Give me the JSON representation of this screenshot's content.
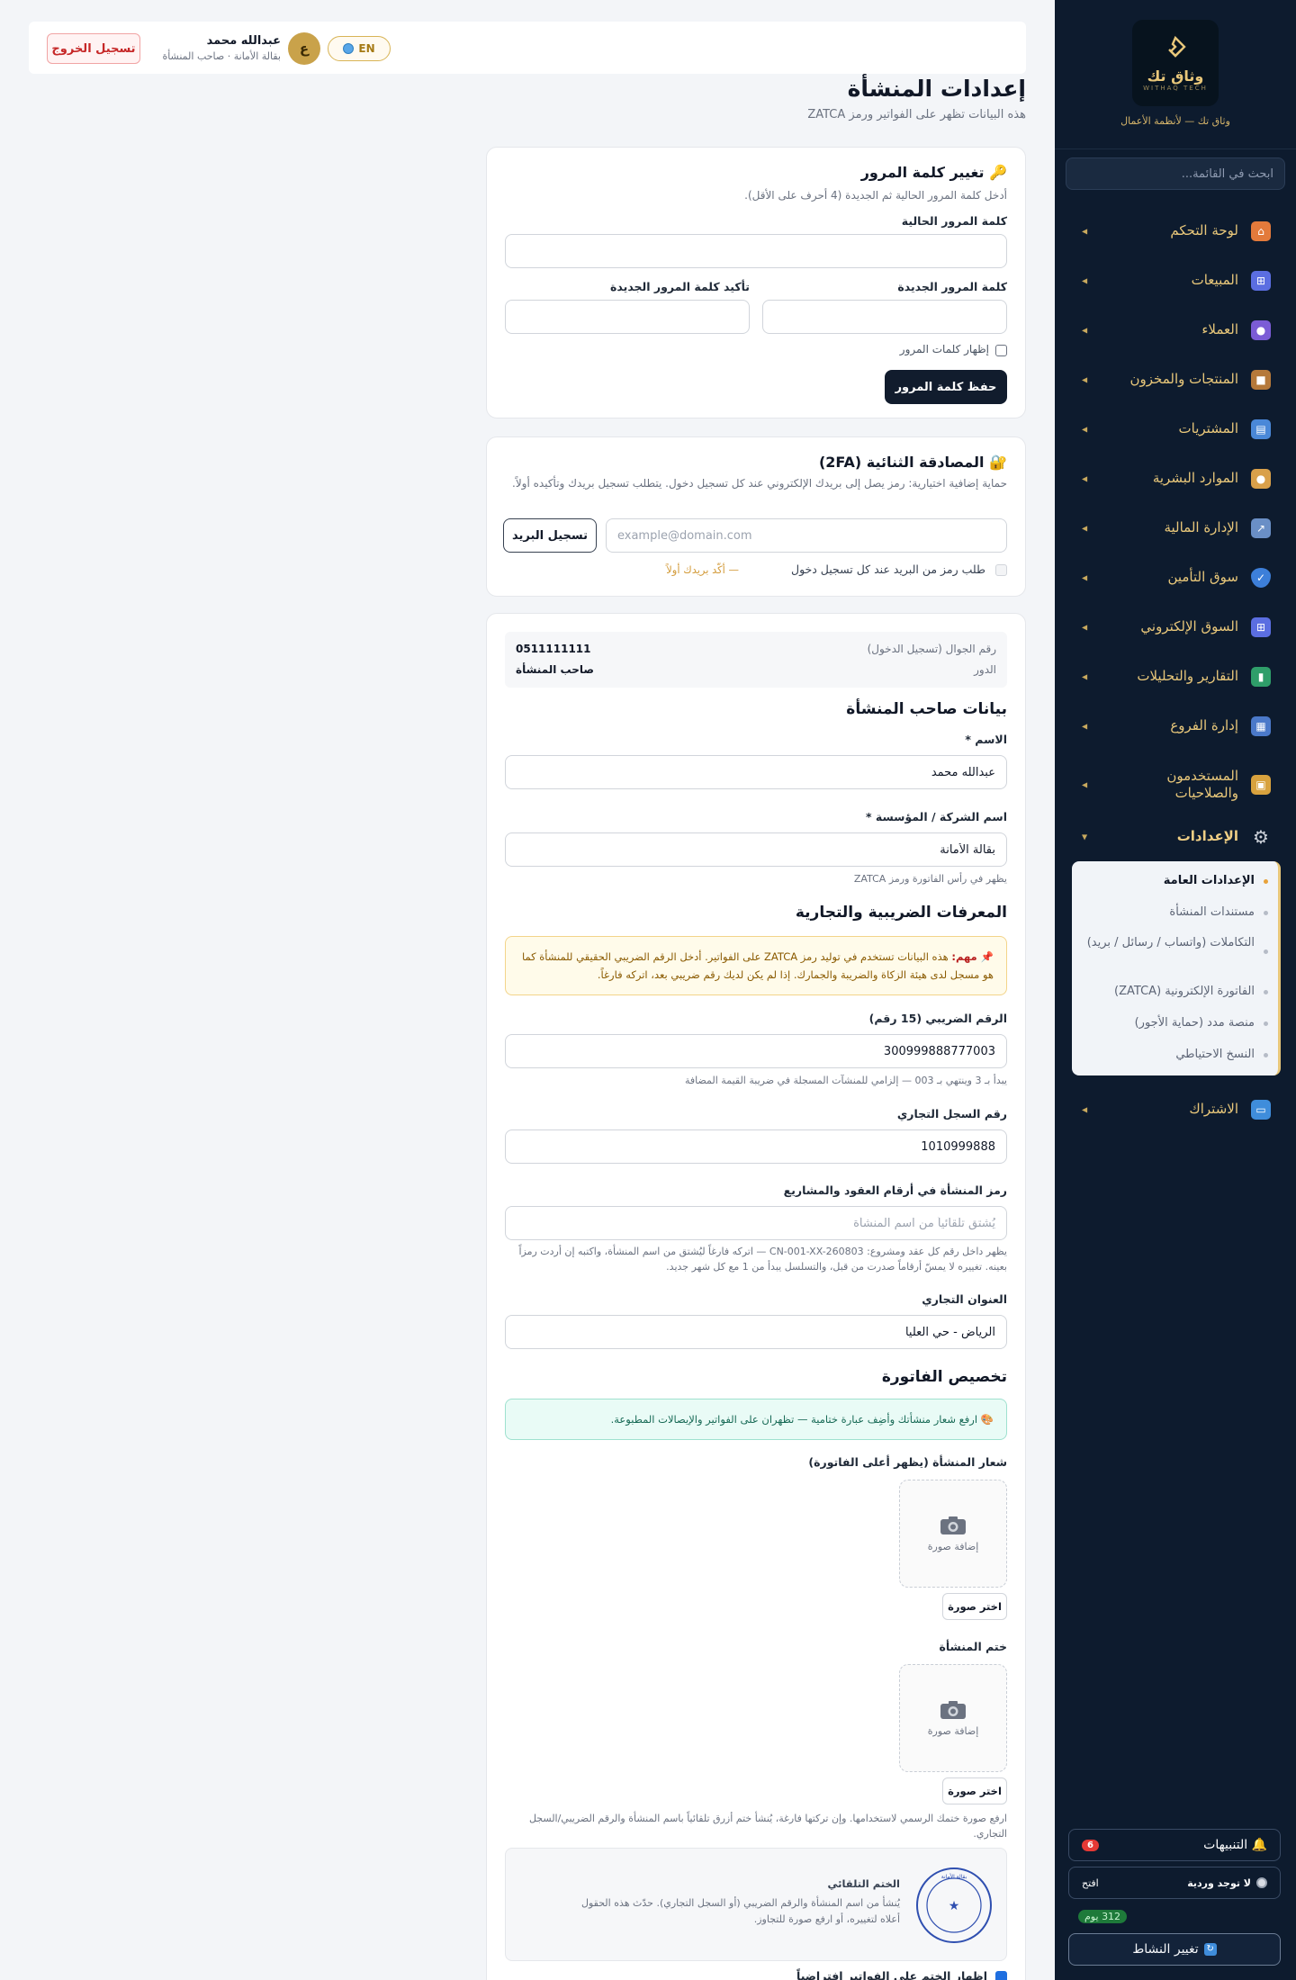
{
  "brand": {
    "name": "وثاق تك",
    "sub": "WITHAQ TECH",
    "tagline": "وثاق تك — لأنظمة الأعمال",
    "gold": "#e8c77a",
    "navy": "#0d1b2e"
  },
  "sidebar": {
    "search_placeholder": "ابحث في القائمة...",
    "items": [
      {
        "label": "لوحة التحكم",
        "icon": "home-icon"
      },
      {
        "label": "المبيعات",
        "icon": "cart-icon"
      },
      {
        "label": "العملاء",
        "icon": "users-icon"
      },
      {
        "label": "المنتجات والمخزون",
        "icon": "box-icon"
      },
      {
        "label": "المشتريات",
        "icon": "inbox-icon"
      },
      {
        "label": "الموارد البشرية",
        "icon": "person-icon"
      },
      {
        "label": "الإدارة المالية",
        "icon": "chart-line-icon"
      },
      {
        "label": "سوق التأمين",
        "icon": "shield-icon"
      },
      {
        "label": "السوق الإلكتروني",
        "icon": "cart-icon"
      },
      {
        "label": "التقارير والتحليلات",
        "icon": "bar-chart-icon"
      },
      {
        "label": "إدارة الفروع",
        "icon": "building-icon"
      },
      {
        "label": "المستخدمون والصلاحيات",
        "icon": "lock-icon"
      },
      {
        "label": "الإعدادات",
        "icon": "gear-icon"
      },
      {
        "label": "الاشتراك",
        "icon": "credit-card-icon"
      }
    ],
    "settings_submenu": [
      "الإعدادات العامة",
      "مستندات المنشأة",
      "التكاملات (واتساب / رسائل / بريد)",
      "الفاتورة الإلكترونية (ZATCA)",
      "منصة مدد (حماية الأجور)",
      "النسخ الاحتياطي"
    ],
    "notifications_label": "التنبيهات",
    "notifications_count": "6",
    "shift_status": "لا توجد وردية",
    "shift_open": "افتح",
    "days_left": "312 يوم",
    "change_activity": "تغيير النشاط"
  },
  "topbar": {
    "logout": "تسجيل الخروج",
    "user_name": "عبدالله محمد",
    "user_sub": "بقالة الأمانة · صاحب المنشأة",
    "avatar_letter": "ع",
    "lang": "EN"
  },
  "page": {
    "title": "إعدادات المنشأة",
    "subtitle": "هذه البيانات تظهر على الفواتير ورمز ZATCA"
  },
  "password": {
    "title": "🔑 تغيير كلمة المرور",
    "desc": "أدخل كلمة المرور الحالية ثم الجديدة (4 أحرف على الأقل).",
    "current_label": "كلمة المرور الحالية",
    "new_label": "كلمة المرور الجديدة",
    "confirm_label": "تأكيد كلمة المرور الجديدة",
    "show_label": "إظهار كلمات المرور",
    "save": "حفظ كلمة المرور"
  },
  "twofa": {
    "title": "🔐 المصادقة الثنائية (2FA)",
    "desc": "حماية إضافية اختيارية: رمز يصل إلى بريدك الإلكتروني عند كل تسجيل دخول. يتطلب تسجيل بريدك وتأكيده أولاً.",
    "email_placeholder": "example@domain.com",
    "register_btn": "تسجيل البريد",
    "require_label": "طلب رمز من البريد عند كل تسجيل دخول",
    "require_note": "— أكّد بريدك أولاً"
  },
  "owner": {
    "phone_label": "رقم الجوال (تسجيل الدخول)",
    "phone_value": "0511111111",
    "role_label": "الدور",
    "role_value": "صاحب المنشأة",
    "section_title": "بيانات صاحب المنشأة",
    "name_label": "الاسم *",
    "name_value": "عبدالله محمد",
    "company_label": "اسم الشركة / المؤسسة *",
    "company_value": "بقالة الأمانة",
    "company_hint": "يظهر في رأس الفاتورة ورمز ZATCA"
  },
  "tax": {
    "section_title": "المعرفات الضريبية والتجارية",
    "warn_bold": "📌 مهم:",
    "warn_text": "هذه البيانات تستخدم في توليد رمز ZATCA على الفواتير. أدخل الرقم الضريبي الحقيقي للمنشأة كما هو مسجل لدى هيئة الزكاة والضريبة والجمارك. إذا لم يكن لديك رقم ضريبي بعد، اتركه فارغاً.",
    "vat_label": "الرقم الضريبي (15 رقم)",
    "vat_value": "300999888777003",
    "vat_hint": "يبدأ بـ 3 وينتهي بـ 003 — إلزامي للمنشآت المسجلة في ضريبة القيمة المضافة",
    "cr_label": "رقم السجل التجاري",
    "cr_value": "1010999888",
    "code_label": "رمز المنشأة في أرقام العقود والمشاريع",
    "code_placeholder": "يُشتق تلقائياً من اسم المنشأة",
    "code_hint": "يظهر داخل رقم كل عقد ومشروع: CN-001-XX-260803 — اتركه فارغاً ليُشتق من اسم المنشأة، واكتبه إن أردت رمزاً بعينه. تغييره لا يمسّ أرقاماً صدرت من قبل، والتسلسل يبدأ من 1 مع كل شهر جديد.",
    "address_label": "العنوان التجاري",
    "address_value": "الرياض - حي العليا"
  },
  "invoice": {
    "section_title": "تخصيص الفاتورة",
    "tip": "🎨 ارفع شعار منشأتك وأضِف عبارة ختامية — تظهران على الفواتير والإيصالات المطبوعة.",
    "logo_label": "شعار المنشأة (يظهر أعلى الفاتورة)",
    "add_image": "إضافة صورة",
    "choose_image": "اختر صورة",
    "stamp_label": "ختم المنشأة",
    "stamp_hint": "ارفع صورة ختمك الرسمي لاستخدامها. وإن تركتها فارغة، يُنشأ ختم أزرق تلقائياً باسم المنشأة والرقم الضريبي/السجل التجاري.",
    "auto_seal_title": "الختم التلقائي",
    "auto_seal_desc": "يُنشأ من اسم المنشأة والرقم الضريبي (أو السجل التجاري). حدّث هذه الحقول أعلاه لتغييره، أو ارفع صورة للتجاوز.",
    "seal_ring_text": "بقالة الأمانة",
    "show_stamp_label": "إظهار الختم على الفواتير افتراضياً"
  }
}
